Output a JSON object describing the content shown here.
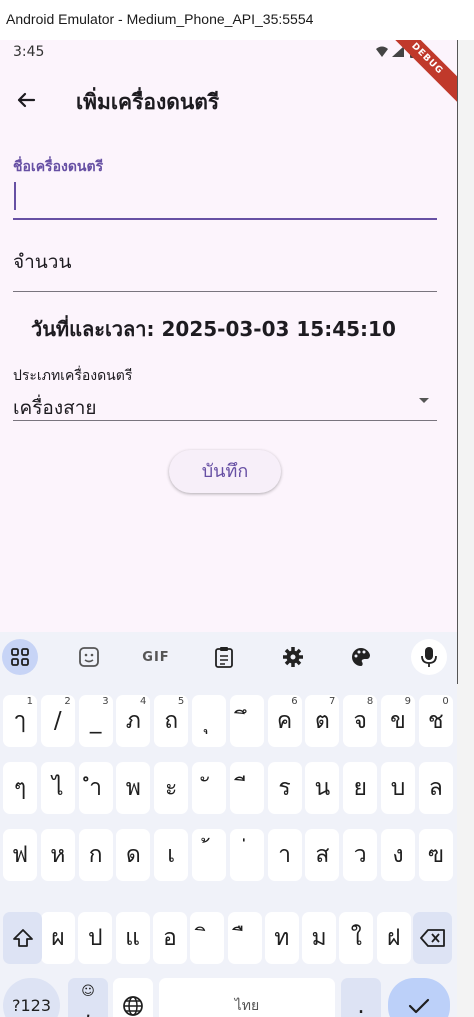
{
  "window": {
    "title": "Android Emulator - Medium_Phone_API_35:5554"
  },
  "status": {
    "time": "3:45",
    "debug_banner": "DEBUG"
  },
  "appbar": {
    "title": "เพิ่มเครื่องดนตรี"
  },
  "form": {
    "name_label": "ชื่อเครื่องดนตรี",
    "name_value": "",
    "quantity_label": "จำนวน",
    "datetime_text": "วันที่และเวลา: 2025-03-03 15:45:10",
    "type_label": "ประเภทเครื่องดนตรี",
    "type_value": "เครื่องสาย",
    "save_label": "บันทึก"
  },
  "keyboard": {
    "toolbar": [
      "apps-icon",
      "emoji-sticker-icon",
      "gif",
      "clipboard-icon",
      "settings-icon",
      "palette-icon",
      "mic-icon"
    ],
    "gif_label": "GIF",
    "row1": [
      {
        "k": "ๅ",
        "h": "1"
      },
      {
        "k": "/",
        "h": "2"
      },
      {
        "k": "_",
        "h": "3"
      },
      {
        "k": "ภ",
        "h": "4"
      },
      {
        "k": "ถ",
        "h": "5"
      },
      {
        "k": "ุ",
        "h": ""
      },
      {
        "k": "ึ",
        "h": ""
      },
      {
        "k": "ค",
        "h": "6"
      },
      {
        "k": "ต",
        "h": "7"
      },
      {
        "k": "จ",
        "h": "8"
      },
      {
        "k": "ข",
        "h": "9"
      },
      {
        "k": "ช",
        "h": "0"
      }
    ],
    "row2": [
      "ๆ",
      "ไ",
      "ำ",
      "พ",
      "ะ",
      "ั",
      "ี",
      "ร",
      "น",
      "ย",
      "บ",
      "ล"
    ],
    "row3": [
      "ฟ",
      "ห",
      "ก",
      "ด",
      "เ",
      "้",
      "่",
      "า",
      "ส",
      "ว",
      "ง",
      "ฃ"
    ],
    "row4": [
      "ผ",
      "ป",
      "แ",
      "อ",
      "ิ",
      "ื",
      "ท",
      "ม",
      "ใ",
      "ฝ"
    ],
    "symbols_label": "?123",
    "comma_label": ",",
    "space_label": "ไทย",
    "period_label": "."
  },
  "colors": {
    "accent": "#6750a4",
    "background": "#fcf4fc",
    "keyboard": "#f0f2f9",
    "enter": "#bcd0f9"
  }
}
